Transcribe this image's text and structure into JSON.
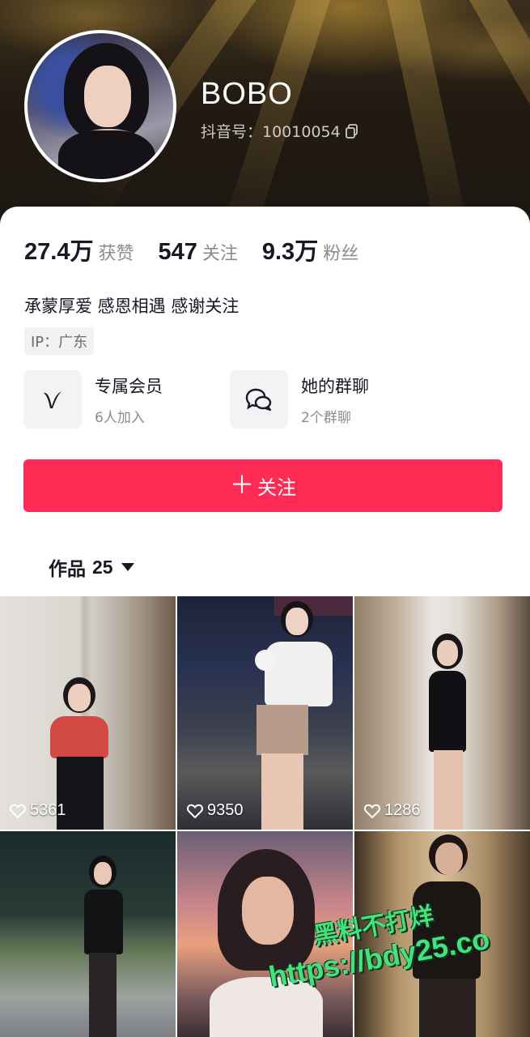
{
  "profile": {
    "nickname": "BOBO",
    "douyin_id": "抖音号：10010054"
  },
  "stats": [
    {
      "num": "27.4万",
      "label": "获赞"
    },
    {
      "num": "547",
      "label": "关注"
    },
    {
      "num": "9.3万",
      "label": "粉丝"
    }
  ],
  "bio": "承蒙厚爱 感恩相遇 感谢关注",
  "ip_tag": "IP：广东",
  "features": [
    {
      "title": "专属会员",
      "sub": "6人加入",
      "icon": "v-membership-icon"
    },
    {
      "title": "她的群聊",
      "sub": "2个群聊",
      "icon": "chat-bubbles-icon"
    }
  ],
  "follow_button": {
    "plus": "＋",
    "label": "关注"
  },
  "works_tab": {
    "label": "作品",
    "count": "25"
  },
  "videos": [
    {
      "likes": "5361"
    },
    {
      "likes": "9350"
    },
    {
      "likes": "1286"
    },
    {
      "likes": ""
    },
    {
      "likes": ""
    },
    {
      "likes": ""
    }
  ],
  "watermark": {
    "line1": "黑料不打烊",
    "line2": "https://bdy25.co"
  },
  "colors": {
    "accent": "#fe2c55",
    "text": "#161823",
    "muted": "#8a8b91"
  }
}
